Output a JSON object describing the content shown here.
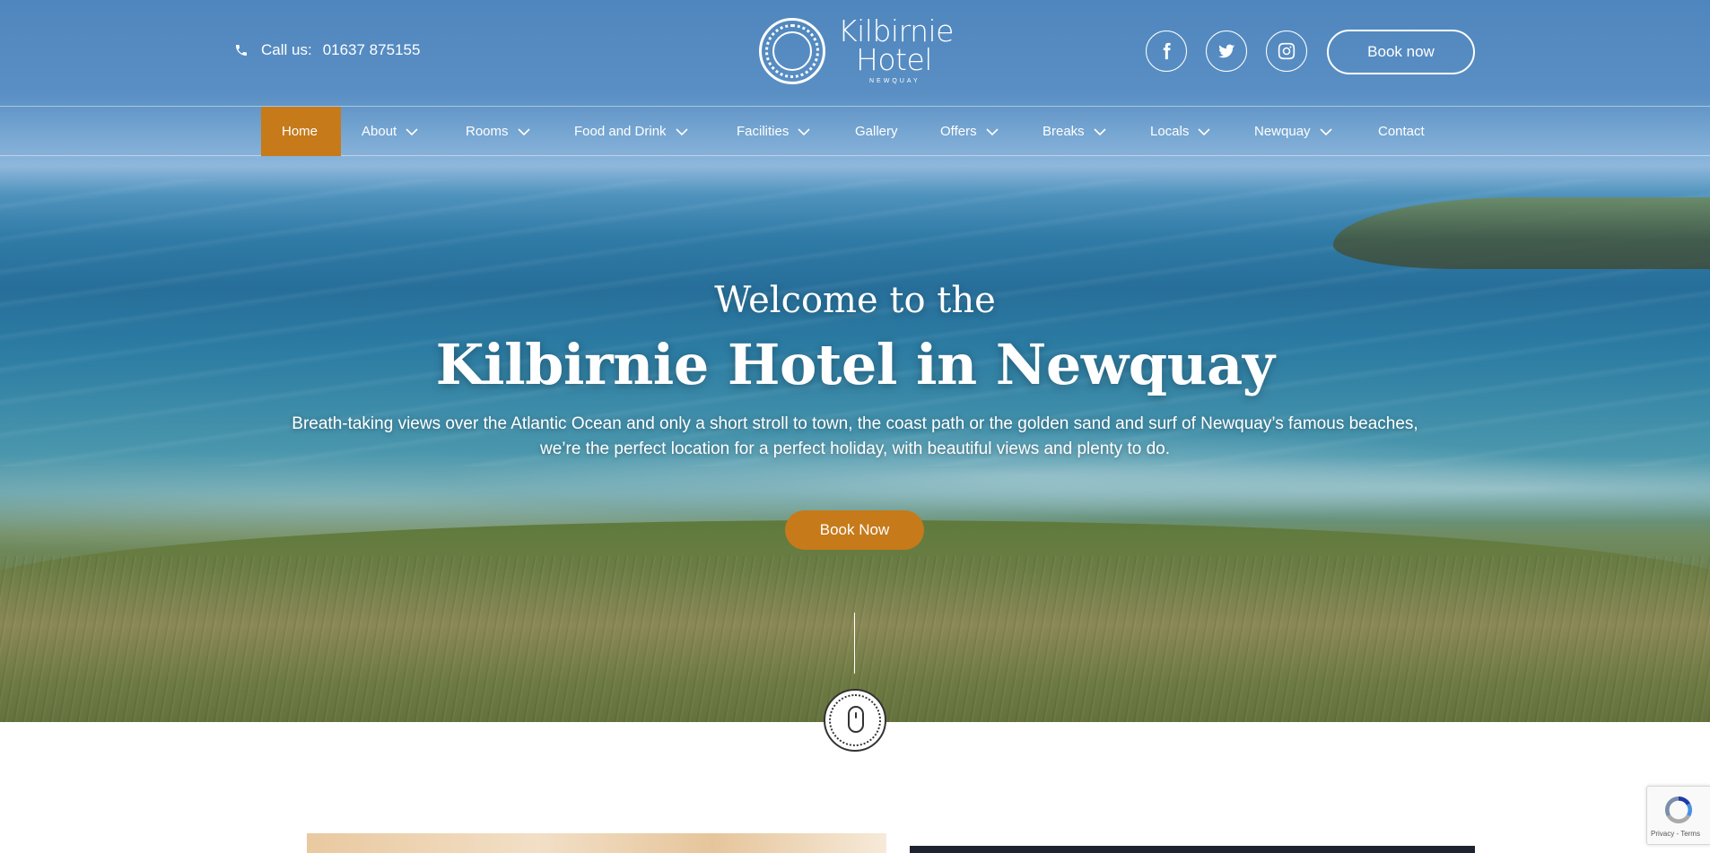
{
  "header": {
    "call_label": "Call us:",
    "phone": "01637 875155",
    "brand_line1": "Kilbirnie",
    "brand_line2": "Hotel",
    "brand_sub": "NEWQUAY",
    "book_label": "Book now",
    "social": [
      "facebook",
      "twitter",
      "instagram"
    ]
  },
  "nav": {
    "items": [
      {
        "label": "Home",
        "active": true,
        "dropdown": false
      },
      {
        "label": "About",
        "dropdown": true
      },
      {
        "label": "Rooms",
        "dropdown": true
      },
      {
        "label": "Food and Drink",
        "dropdown": true
      },
      {
        "label": "Facilities",
        "dropdown": true
      },
      {
        "label": "Gallery",
        "dropdown": false
      },
      {
        "label": "Offers",
        "dropdown": true
      },
      {
        "label": "Breaks",
        "dropdown": true
      },
      {
        "label": "Locals",
        "dropdown": true
      },
      {
        "label": "Newquay",
        "dropdown": true
      },
      {
        "label": "Contact",
        "dropdown": false
      }
    ]
  },
  "hero": {
    "pre_title": "Welcome to the",
    "title": "Kilbirnie Hotel in Newquay",
    "description_line1": "Breath-taking views over the Atlantic Ocean and only a short stroll to town, the coast path or the golden sand and surf of Newquay’s famous beaches,",
    "description_line2": "we’re the perfect location for a perfect holiday, with beautiful views and plenty to do.",
    "cta_label": "Book Now"
  },
  "recaptcha": {
    "text": "Privacy - Terms"
  },
  "colors": {
    "accent": "#c67a1a",
    "text_on_hero": "#ffffff",
    "dark_panel": "#1d2430"
  },
  "icons": {
    "phone": "phone-icon",
    "facebook": "facebook-icon",
    "twitter": "twitter-icon",
    "instagram": "instagram-icon",
    "dropdown": "chevron-down-icon",
    "scroll": "mouse-scroll-icon"
  }
}
